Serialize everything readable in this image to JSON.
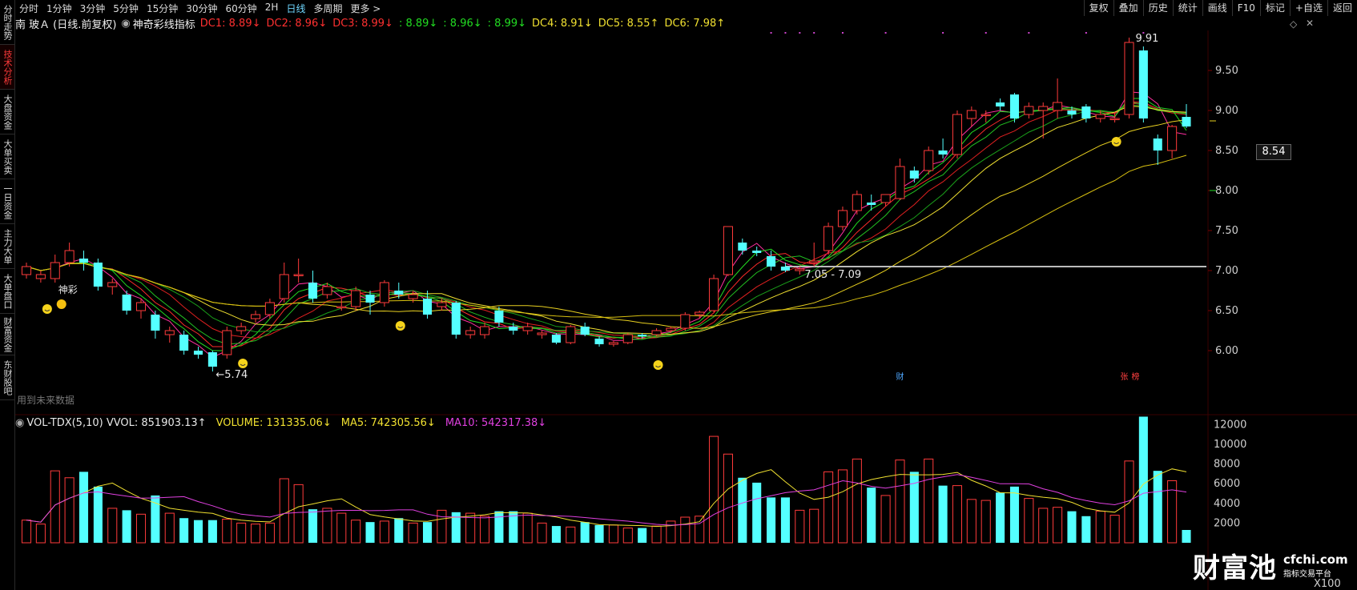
{
  "left_tabs": [
    {
      "label": "分时走势",
      "active": false
    },
    {
      "label": "技术分析",
      "active": true
    },
    {
      "label": "大盘资金",
      "active": false
    },
    {
      "label": "大单买卖",
      "active": false
    },
    {
      "label": "一日资金",
      "active": false
    },
    {
      "label": "主力大单",
      "active": false
    },
    {
      "label": "大单盘口",
      "active": false
    },
    {
      "label": "财富资金",
      "active": false
    },
    {
      "label": "东财股吧",
      "active": false
    }
  ],
  "periods": [
    "分时",
    "1分钟",
    "3分钟",
    "5分钟",
    "15分钟",
    "30分钟",
    "60分钟",
    "2H",
    "日线",
    "多周期",
    "更多 >"
  ],
  "active_period": "日线",
  "toolbar_right": [
    "复权",
    "叠加",
    "历史",
    "统计",
    "画线",
    "F10",
    "标记",
    "+自选",
    "返回"
  ],
  "stock": {
    "name": "南 玻Ａ",
    "mode": "(日线.前复权)",
    "indicator_name": "神奇彩线指标"
  },
  "indicator_values": [
    {
      "text": "DC1: 8.89↓",
      "color": "#ff3030"
    },
    {
      "text": "DC2: 8.96↓",
      "color": "#ff3030"
    },
    {
      "text": "DC3: 8.99↓",
      "color": "#ff3030"
    },
    {
      "text": ": 8.89↓",
      "color": "#22dd22"
    },
    {
      "text": ": 8.96↓",
      "color": "#22dd22"
    },
    {
      "text": ": 8.99↓",
      "color": "#22dd22"
    },
    {
      "text": "DC4: 8.91↓",
      "color": "#f0e030"
    },
    {
      "text": "DC5: 8.55↑",
      "color": "#f0e030"
    },
    {
      "text": "DC6: 7.98↑",
      "color": "#f0e030"
    }
  ],
  "volume_values": [
    {
      "text": "VOL-TDX(5,10)  VVOL: 851903.13↑",
      "color": "#e8e8e8"
    },
    {
      "text": "VOLUME: 131335.06↓",
      "color": "#f0e030"
    },
    {
      "text": "MA5: 742305.56↓",
      "color": "#f0e030"
    },
    {
      "text": "MA10: 542317.38↓",
      "color": "#e040e0"
    }
  ],
  "price_axis": [
    "9.50",
    "9.00",
    "8.50",
    "8.00",
    "7.50",
    "7.00",
    "6.50",
    "6.00"
  ],
  "volume_axis": [
    "12000",
    "10000",
    "8000",
    "6000",
    "4000",
    "2000"
  ],
  "volume_unit": "X100",
  "current_price": "8.54",
  "labels": {
    "high": "9.91",
    "low": "←5.74",
    "range": "7.05 - 7.09",
    "shencai": "神彩",
    "future_data": "用到未来数据",
    "cai": "财",
    "zhang": "张",
    "bang": "榜"
  },
  "watermark": {
    "main": "财富池",
    "domain": "cfchi.com",
    "sub": "指标交易平台"
  },
  "chart_data": {
    "type": "candlestick",
    "candles": [
      {
        "o": 6.95,
        "c": 7.05,
        "h": 7.1,
        "l": 6.9
      },
      {
        "o": 6.9,
        "c": 6.95,
        "h": 7.0,
        "l": 6.85
      },
      {
        "o": 6.9,
        "c": 7.1,
        "h": 7.2,
        "l": 6.85
      },
      {
        "o": 7.1,
        "c": 7.25,
        "h": 7.35,
        "l": 7.05
      },
      {
        "o": 7.15,
        "c": 7.1,
        "h": 7.25,
        "l": 7.0
      },
      {
        "o": 7.1,
        "c": 6.8,
        "h": 7.15,
        "l": 6.75
      },
      {
        "o": 6.8,
        "c": 6.85,
        "h": 6.9,
        "l": 6.7
      },
      {
        "o": 6.7,
        "c": 6.5,
        "h": 6.75,
        "l": 6.45
      },
      {
        "o": 6.5,
        "c": 6.6,
        "h": 6.65,
        "l": 6.4
      },
      {
        "o": 6.45,
        "c": 6.25,
        "h": 6.5,
        "l": 6.15
      },
      {
        "o": 6.2,
        "c": 6.25,
        "h": 6.3,
        "l": 6.1
      },
      {
        "o": 6.2,
        "c": 6.0,
        "h": 6.25,
        "l": 5.95
      },
      {
        "o": 6.0,
        "c": 5.95,
        "h": 6.05,
        "l": 5.9
      },
      {
        "o": 5.98,
        "c": 5.8,
        "h": 6.0,
        "l": 5.74
      },
      {
        "o": 5.95,
        "c": 6.25,
        "h": 6.3,
        "l": 5.9
      },
      {
        "o": 6.25,
        "c": 6.3,
        "h": 6.35,
        "l": 6.2
      },
      {
        "o": 6.4,
        "c": 6.45,
        "h": 6.5,
        "l": 6.35
      },
      {
        "o": 6.45,
        "c": 6.6,
        "h": 6.65,
        "l": 6.4
      },
      {
        "o": 6.65,
        "c": 6.95,
        "h": 7.1,
        "l": 6.6
      },
      {
        "o": 6.95,
        "c": 6.95,
        "h": 7.15,
        "l": 6.85
      },
      {
        "o": 6.85,
        "c": 6.65,
        "h": 7.0,
        "l": 6.6
      },
      {
        "o": 6.7,
        "c": 6.8,
        "h": 6.85,
        "l": 6.65
      },
      {
        "o": 6.55,
        "c": 6.55,
        "h": 6.65,
        "l": 6.5
      },
      {
        "o": 6.55,
        "c": 6.75,
        "h": 6.8,
        "l": 6.5
      },
      {
        "o": 6.7,
        "c": 6.6,
        "h": 6.75,
        "l": 6.45
      },
      {
        "o": 6.6,
        "c": 6.85,
        "h": 6.88,
        "l": 6.55
      },
      {
        "o": 6.75,
        "c": 6.7,
        "h": 6.85,
        "l": 6.65
      },
      {
        "o": 6.65,
        "c": 6.7,
        "h": 6.75,
        "l": 6.6
      },
      {
        "o": 6.65,
        "c": 6.45,
        "h": 6.75,
        "l": 6.4
      },
      {
        "o": 6.55,
        "c": 6.6,
        "h": 6.65,
        "l": 6.5
      },
      {
        "o": 6.6,
        "c": 6.2,
        "h": 6.62,
        "l": 6.15
      },
      {
        "o": 6.2,
        "c": 6.25,
        "h": 6.3,
        "l": 6.15
      },
      {
        "o": 6.2,
        "c": 6.3,
        "h": 6.35,
        "l": 6.15
      },
      {
        "o": 6.5,
        "c": 6.35,
        "h": 6.55,
        "l": 6.3
      },
      {
        "o": 6.3,
        "c": 6.25,
        "h": 6.35,
        "l": 6.2
      },
      {
        "o": 6.25,
        "c": 6.3,
        "h": 6.35,
        "l": 6.2
      },
      {
        "o": 6.2,
        "c": 6.22,
        "h": 6.25,
        "l": 6.15
      },
      {
        "o": 6.2,
        "c": 6.1,
        "h": 6.22,
        "l": 6.08
      },
      {
        "o": 6.1,
        "c": 6.3,
        "h": 6.32,
        "l": 6.08
      },
      {
        "o": 6.3,
        "c": 6.2,
        "h": 6.35,
        "l": 6.18
      },
      {
        "o": 6.15,
        "c": 6.08,
        "h": 6.18,
        "l": 6.05
      },
      {
        "o": 6.08,
        "c": 6.1,
        "h": 6.12,
        "l": 6.05
      },
      {
        "o": 6.1,
        "c": 6.2,
        "h": 6.22,
        "l": 6.08
      },
      {
        "o": 6.2,
        "c": 6.18,
        "h": 6.22,
        "l": 6.15
      },
      {
        "o": 6.2,
        "c": 6.25,
        "h": 6.28,
        "l": 6.18
      },
      {
        "o": 6.25,
        "c": 6.28,
        "h": 6.3,
        "l": 6.22
      },
      {
        "o": 6.28,
        "c": 6.45,
        "h": 6.48,
        "l": 6.25
      },
      {
        "o": 6.45,
        "c": 6.48,
        "h": 6.5,
        "l": 6.4
      },
      {
        "o": 6.5,
        "c": 6.9,
        "h": 6.95,
        "l": 6.48
      },
      {
        "o": 6.95,
        "c": 7.55,
        "h": 7.55,
        "l": 6.93
      },
      {
        "o": 7.35,
        "c": 7.25,
        "h": 7.4,
        "l": 7.2
      },
      {
        "o": 7.25,
        "c": 7.22,
        "h": 7.3,
        "l": 7.18
      },
      {
        "o": 7.18,
        "c": 7.05,
        "h": 7.25,
        "l": 7.0
      },
      {
        "o": 7.05,
        "c": 7.0,
        "h": 7.1,
        "l": 6.98
      },
      {
        "o": 7.0,
        "c": 7.02,
        "h": 7.05,
        "l": 6.95
      },
      {
        "o": 7.1,
        "c": 7.12,
        "h": 7.35,
        "l": 7.05
      },
      {
        "o": 7.25,
        "c": 7.55,
        "h": 7.6,
        "l": 7.2
      },
      {
        "o": 7.55,
        "c": 7.75,
        "h": 7.8,
        "l": 7.5
      },
      {
        "o": 7.75,
        "c": 7.95,
        "h": 8.0,
        "l": 7.7
      },
      {
        "o": 7.85,
        "c": 7.82,
        "h": 7.95,
        "l": 7.75
      },
      {
        "o": 7.85,
        "c": 7.95,
        "h": 7.95,
        "l": 7.8
      },
      {
        "o": 7.9,
        "c": 8.3,
        "h": 8.4,
        "l": 7.88
      },
      {
        "o": 8.25,
        "c": 8.15,
        "h": 8.3,
        "l": 8.1
      },
      {
        "o": 8.25,
        "c": 8.5,
        "h": 8.55,
        "l": 8.2
      },
      {
        "o": 8.5,
        "c": 8.45,
        "h": 8.65,
        "l": 8.4
      },
      {
        "o": 8.45,
        "c": 8.95,
        "h": 9.0,
        "l": 8.4
      },
      {
        "o": 8.9,
        "c": 9.0,
        "h": 9.05,
        "l": 8.8
      },
      {
        "o": 8.95,
        "c": 8.95,
        "h": 9.0,
        "l": 8.85
      },
      {
        "o": 9.1,
        "c": 9.05,
        "h": 9.15,
        "l": 9.0
      },
      {
        "o": 9.2,
        "c": 8.9,
        "h": 9.22,
        "l": 8.85
      },
      {
        "o": 8.95,
        "c": 9.05,
        "h": 9.1,
        "l": 8.9
      },
      {
        "o": 9.0,
        "c": 9.05,
        "h": 9.1,
        "l": 8.65
      },
      {
        "o": 9.0,
        "c": 9.1,
        "h": 9.4,
        "l": 8.9
      },
      {
        "o": 9.0,
        "c": 8.95,
        "h": 9.05,
        "l": 8.9
      },
      {
        "o": 9.05,
        "c": 8.9,
        "h": 9.08,
        "l": 8.85
      },
      {
        "o": 8.9,
        "c": 8.95,
        "h": 9.0,
        "l": 8.85
      },
      {
        "o": 8.9,
        "c": 8.9,
        "h": 8.98,
        "l": 8.85
      },
      {
        "o": 8.95,
        "c": 9.85,
        "h": 9.91,
        "l": 8.9
      },
      {
        "o": 9.75,
        "c": 8.9,
        "h": 9.8,
        "l": 8.85
      },
      {
        "o": 8.65,
        "c": 8.5,
        "h": 8.7,
        "l": 8.32
      },
      {
        "o": 8.5,
        "c": 8.8,
        "h": 8.82,
        "l": 8.4
      },
      {
        "o": 8.92,
        "c": 8.8,
        "h": 9.08,
        "l": 8.78
      }
    ],
    "volume_hundreds": [
      2300,
      1900,
      7300,
      6600,
      7200,
      5700,
      3500,
      3300,
      2900,
      4800,
      3000,
      2500,
      2300,
      2300,
      2400,
      2000,
      1900,
      2000,
      6500,
      5900,
      3400,
      3500,
      3000,
      2300,
      2100,
      2200,
      2500,
      2000,
      2100,
      3300,
      3100,
      3000,
      2700,
      3200,
      3200,
      3000,
      2000,
      1700,
      1600,
      2100,
      1800,
      1800,
      1500,
      1500,
      1700,
      2200,
      2600,
      2700,
      10800,
      9000,
      6600,
      6100,
      4600,
      4600,
      3300,
      3400,
      7200,
      7400,
      8500,
      5600,
      4800,
      8400,
      7200,
      8500,
      5800,
      5800,
      4400,
      4300,
      5100,
      5700,
      4500,
      3500,
      3600,
      3200,
      2700,
      3200,
      2800,
      8300,
      12800,
      7300,
      6300,
      1300
    ],
    "ma5_hundreds_last": 7423,
    "ma10_hundreds_last": 5423,
    "price_range": [
      5.6,
      10.0
    ],
    "volume_range": [
      0,
      13000
    ],
    "hline": 7.05
  }
}
